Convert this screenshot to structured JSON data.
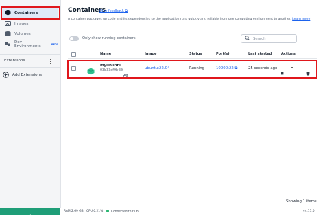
{
  "sidebar": {
    "items": [
      {
        "label": "Containers",
        "icon": "containers-icon"
      },
      {
        "label": "Images",
        "icon": "images-icon"
      },
      {
        "label": "Volumes",
        "icon": "volumes-icon"
      },
      {
        "label": "Dev Environments",
        "icon": "dev-environments-icon",
        "badge": "BETA"
      }
    ],
    "extensions_label": "Extensions",
    "add_extensions_label": "Add Extensions"
  },
  "main": {
    "title": "Containers",
    "feedback_link": "Give feedback",
    "description": "A container packages up code and its dependencies so the application runs quickly and reliably from one computing environment to another.",
    "learn_more": "Learn more",
    "toggle_label": "Only show running containers",
    "search_placeholder": "Search"
  },
  "table": {
    "headers": [
      "Name",
      "Image",
      "Status",
      "Port(s)",
      "Last started",
      "Actions"
    ],
    "rows": [
      {
        "name": "myubuntu",
        "id": "03b33df9b48f",
        "image": "ubuntu:22.04",
        "status": "Running",
        "ports": "10000:22",
        "last_started": "25 seconds ago"
      }
    ],
    "showing": "Showing 1 items"
  },
  "footer": {
    "ram": "RAM 2.69 GB",
    "cpu": "CPU 0.21%",
    "hub": "Connected to Hub",
    "version": "v4.17.0"
  },
  "colors": {
    "accent": "#1d63ed",
    "highlight": "#e0171c",
    "whale_bar": "#1f9e78"
  }
}
